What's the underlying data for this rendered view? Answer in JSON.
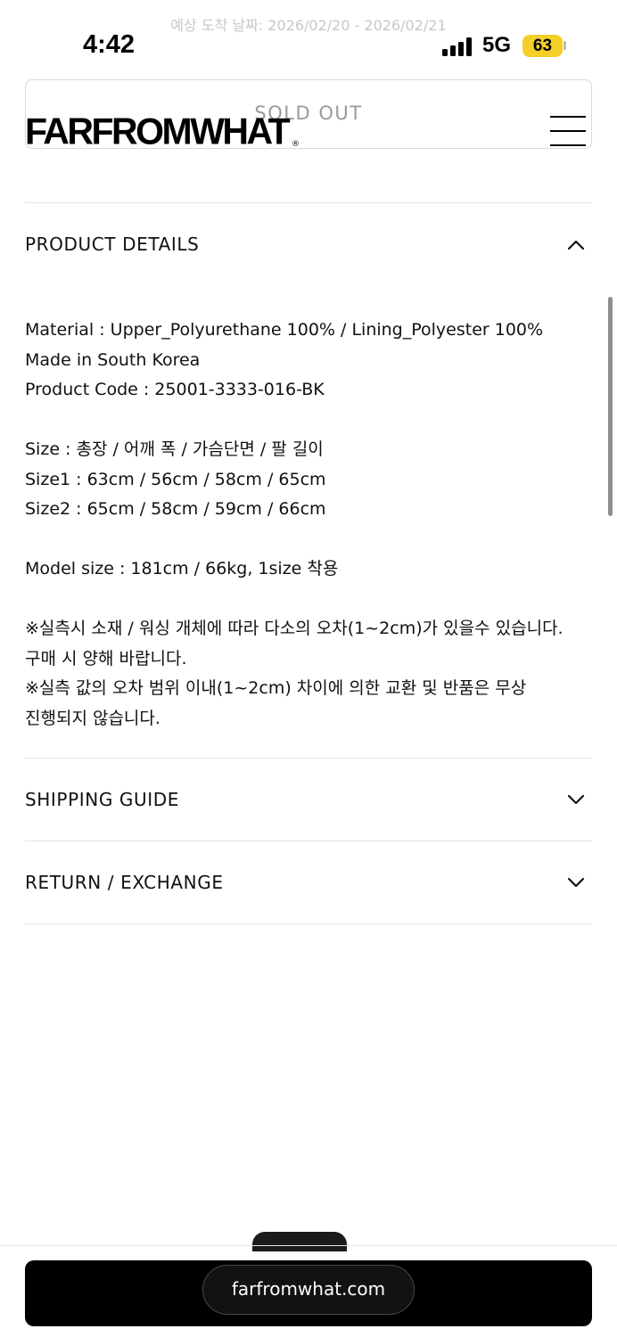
{
  "ghost_text": "예상 도착 날짜: 2026/02/20 - 2026/02/21",
  "status_bar": {
    "time": "4:42",
    "network": "5G",
    "battery": "63"
  },
  "header": {
    "logo": "FARFROMWHAT",
    "logo_mark": "®",
    "status": "SOLD OUT"
  },
  "sections": {
    "product_details": {
      "title": "PRODUCT DETAILS",
      "expanded": true,
      "lines": [
        "Material : Upper_Polyurethane 100% / Lining_Polyester 100%",
        "Made in South Korea",
        "Product Code : 25001-3333-016-BK",
        "",
        "Size : 총장 / 어깨 폭 / 가슴단면 / 팔 길이",
        "Size1 : 63cm / 56cm / 58cm / 65cm",
        "Size2 : 65cm / 58cm / 59cm / 66cm",
        "",
        "Model size : 181cm / 66kg, 1size 착용",
        "",
        "※실측시 소재 / 워싱 개체에 따라 다소의 오차(1~2cm)가 있을수 있습니다.",
        "구매 시 양해 바랍니다.",
        "※실측 값의 오차 범위 이내(1~2cm) 차이에 의한 교환 및 반품은 무상",
        "진행되지 않습니다."
      ]
    },
    "shipping_guide": {
      "title": "SHIPPING GUIDE",
      "expanded": false
    },
    "return_exchange": {
      "title": "RETURN / EXCHANGE",
      "expanded": false
    }
  },
  "browser": {
    "url": "farfromwhat.com"
  },
  "icons": {
    "chevron_up": "chevron-up-icon",
    "chevron_down": "chevron-down-icon",
    "menu": "hamburger-menu-icon",
    "signal": "cellular-signal-icon",
    "battery": "battery-icon"
  }
}
